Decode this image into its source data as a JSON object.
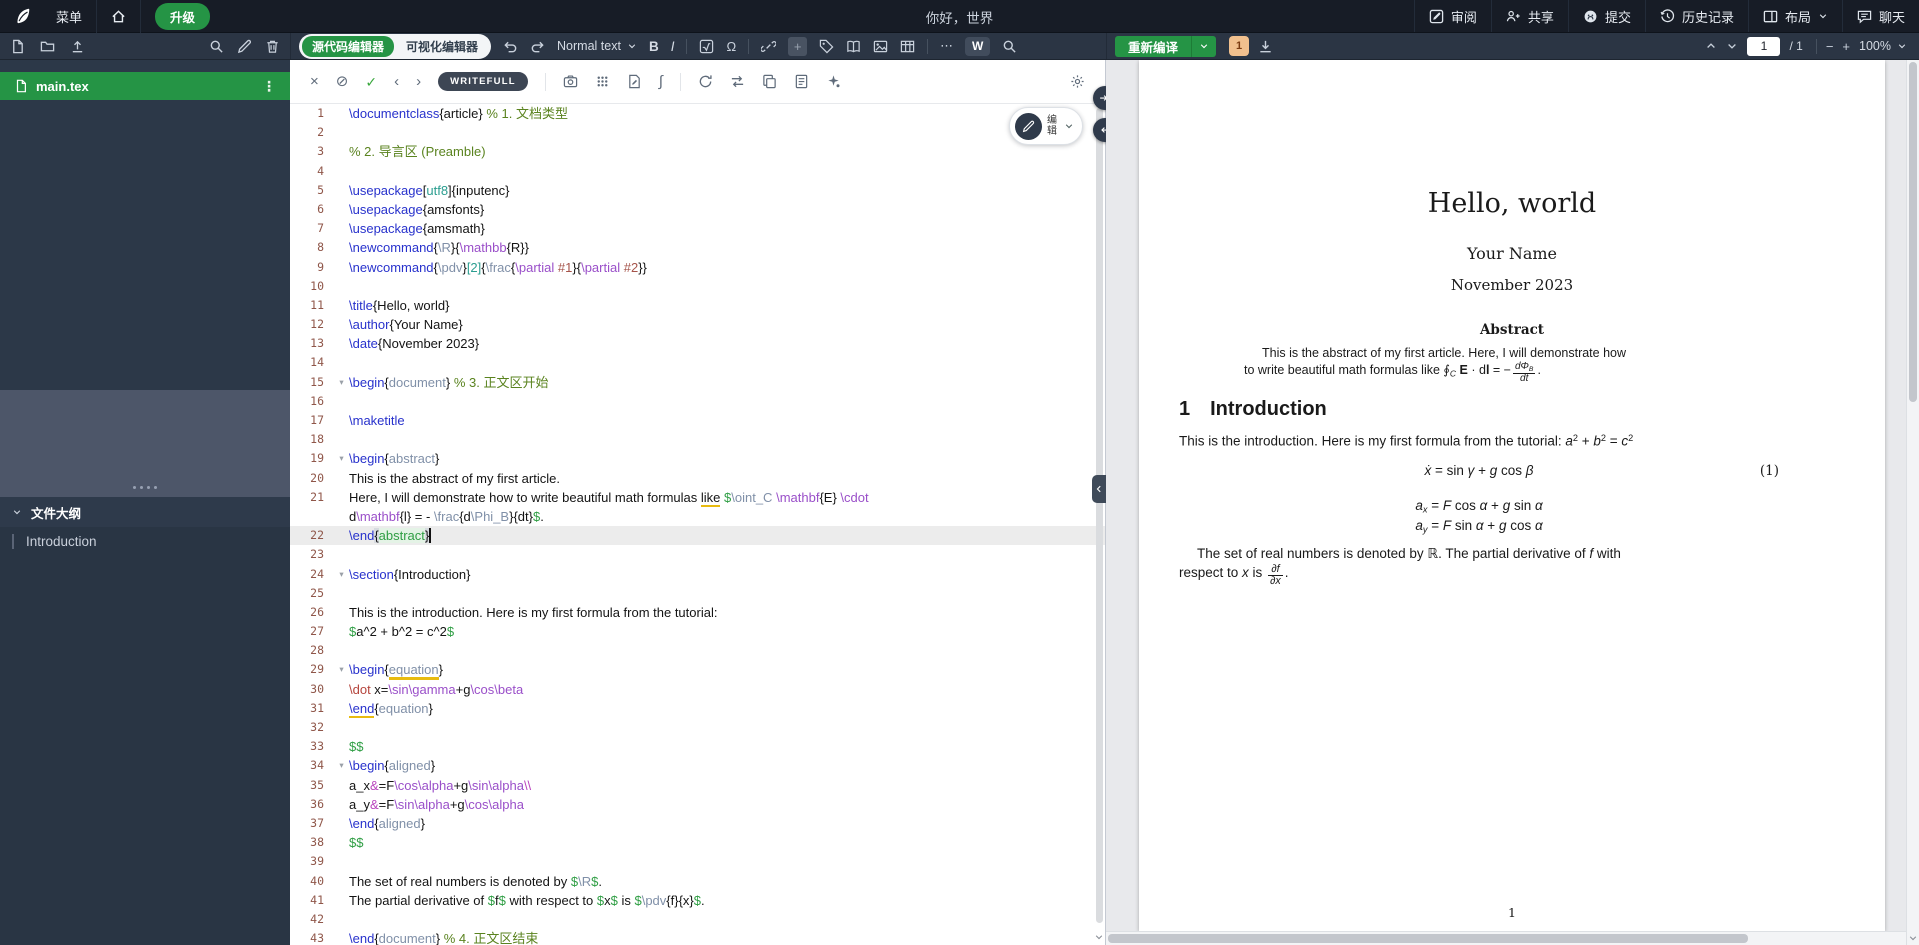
{
  "topbar": {
    "menu": "菜单",
    "upgrade": "升级",
    "project_title": "你好，世界",
    "review": "审阅",
    "share": "共享",
    "submit": "提交",
    "history": "历史记录",
    "layout": "布局",
    "chat": "聊天"
  },
  "toolbar": {
    "source_editor": "源代码编辑器",
    "visual_editor": "可视化编辑器",
    "paragraph_style": "Normal text",
    "bold": "B",
    "italic": "I",
    "omega": "Ω",
    "more": "⋯",
    "comment_plus": "+",
    "writefull_badge": "W"
  },
  "writefull": {
    "close": "×",
    "block": "⊘",
    "check": "✓",
    "prev": "‹",
    "next": "›",
    "label": "WRITEFULL",
    "integral": "∫"
  },
  "pdfbar": {
    "recompile": "重新编译",
    "logs_badge": "1",
    "page_current": "1",
    "page_total": "/ 1",
    "zoom": "100%",
    "zoom_minus": "−",
    "zoom_plus": "+"
  },
  "sidebar": {
    "file": "main.tex",
    "kebab": "⋮",
    "outline_header": "文件大纲",
    "outline_items": [
      "Introduction"
    ]
  },
  "edit_widget": {
    "label": "编辑"
  },
  "editor": {
    "rows": [
      {
        "n": "1",
        "s": [
          {
            "t": "\\documentclass",
            "c": "k"
          },
          {
            "t": "{article}"
          },
          {
            "t": " % 1. 文档类型",
            "c": "c0"
          }
        ]
      },
      {
        "n": "2",
        "s": []
      },
      {
        "n": "3",
        "s": [
          {
            "t": "% 2. 导言区 (Preamble)",
            "c": "c0"
          }
        ]
      },
      {
        "n": "4",
        "s": []
      },
      {
        "n": "5",
        "s": [
          {
            "t": "\\usepackage",
            "c": "k"
          },
          {
            "t": "["
          },
          {
            "t": "utf8",
            "c": "o"
          },
          {
            "t": "]{inputenc}"
          }
        ]
      },
      {
        "n": "6",
        "s": [
          {
            "t": "\\usepackage",
            "c": "k"
          },
          {
            "t": "{amsfonts}"
          }
        ]
      },
      {
        "n": "7",
        "s": [
          {
            "t": "\\usepackage",
            "c": "k"
          },
          {
            "t": "{amsmath}"
          }
        ]
      },
      {
        "n": "8",
        "s": [
          {
            "t": "\\newcommand",
            "c": "k"
          },
          {
            "t": "{"
          },
          {
            "t": "\\R",
            "c": "e"
          },
          {
            "t": "}{"
          },
          {
            "t": "\\mathbb",
            "c": "m"
          },
          {
            "t": "{R}}"
          }
        ]
      },
      {
        "n": "9",
        "s": [
          {
            "t": "\\newcommand",
            "c": "k"
          },
          {
            "t": "{"
          },
          {
            "t": "\\pdv",
            "c": "e"
          },
          {
            "t": "}"
          },
          {
            "t": "[2]",
            "c": "o"
          },
          {
            "t": "{"
          },
          {
            "t": "\\frac",
            "c": "e"
          },
          {
            "t": "{"
          },
          {
            "t": "\\partial",
            "c": "m"
          },
          {
            "t": " "
          },
          {
            "t": "#1",
            "c": "pr"
          },
          {
            "t": "}{"
          },
          {
            "t": "\\partial",
            "c": "m"
          },
          {
            "t": " "
          },
          {
            "t": "#2",
            "c": "pr"
          },
          {
            "t": "}}"
          }
        ]
      },
      {
        "n": "10",
        "s": []
      },
      {
        "n": "11",
        "s": [
          {
            "t": "\\title",
            "c": "k"
          },
          {
            "t": "{Hello, world}"
          }
        ]
      },
      {
        "n": "12",
        "s": [
          {
            "t": "\\author",
            "c": "k"
          },
          {
            "t": "{Your Name}"
          }
        ]
      },
      {
        "n": "13",
        "s": [
          {
            "t": "\\date",
            "c": "k"
          },
          {
            "t": "{November 2023}"
          }
        ]
      },
      {
        "n": "14",
        "s": []
      },
      {
        "n": "15",
        "f": 1,
        "s": [
          {
            "t": "\\begin",
            "c": "k"
          },
          {
            "t": "{"
          },
          {
            "t": "document",
            "c": "e"
          },
          {
            "t": "}"
          },
          {
            "t": " % 3. 正文区开始",
            "c": "c0"
          }
        ]
      },
      {
        "n": "16",
        "s": []
      },
      {
        "n": "17",
        "s": [
          {
            "t": "\\maketitle",
            "c": "k"
          }
        ]
      },
      {
        "n": "18",
        "s": []
      },
      {
        "n": "19",
        "f": 1,
        "s": [
          {
            "t": "\\begin",
            "c": "k"
          },
          {
            "t": "{"
          },
          {
            "t": "abstract",
            "c": "e"
          },
          {
            "t": "}"
          }
        ]
      },
      {
        "n": "20",
        "s": [
          {
            "t": "This is the abstract of my first article."
          }
        ]
      },
      {
        "n": "21",
        "s": [
          {
            "t": "Here, I will demonstrate how to write beautiful math formulas "
          },
          {
            "t": "like",
            "c": "sp"
          },
          {
            "t": " "
          },
          {
            "t": "$",
            "c": "d"
          },
          {
            "t": "\\oint_C",
            "c": "e"
          },
          {
            "t": " "
          },
          {
            "t": "\\mathbf",
            "c": "m"
          },
          {
            "t": "{E}"
          },
          {
            "t": " "
          },
          {
            "t": "\\cdot",
            "c": "m"
          }
        ]
      },
      {
        "n": "",
        "s": [
          {
            "t": "d"
          },
          {
            "t": "\\mathbf",
            "c": "m"
          },
          {
            "t": "{l} = - "
          },
          {
            "t": "\\frac",
            "c": "e"
          },
          {
            "t": "{d"
          },
          {
            "t": "\\Phi_B",
            "c": "e"
          },
          {
            "t": "}{dt}"
          },
          {
            "t": "$",
            "c": "d"
          },
          {
            "t": "."
          }
        ]
      },
      {
        "n": "22",
        "a": 1,
        "s": [
          {
            "t": "\\end",
            "c": "k"
          },
          {
            "t": "{",
            "c": "bm"
          },
          {
            "t": "abstract",
            "c": "em"
          },
          {
            "t": "}",
            "c": "bm"
          }
        ]
      },
      {
        "n": "23",
        "s": []
      },
      {
        "n": "24",
        "f": 1,
        "s": [
          {
            "t": "\\section",
            "c": "k"
          },
          {
            "t": "{Introduction}"
          }
        ]
      },
      {
        "n": "25",
        "s": []
      },
      {
        "n": "26",
        "s": [
          {
            "t": "This is the introduction. Here is my first formula from the tutorial:"
          }
        ]
      },
      {
        "n": "27",
        "s": [
          {
            "t": "$",
            "c": "d"
          },
          {
            "t": "a^2 + b^2 = c^2"
          },
          {
            "t": "$",
            "c": "d"
          }
        ]
      },
      {
        "n": "28",
        "s": []
      },
      {
        "n": "29",
        "f": 1,
        "s": [
          {
            "t": "\\begin",
            "c": "k"
          },
          {
            "t": "{"
          },
          {
            "t": "equation",
            "c": "e sp"
          },
          {
            "t": "}"
          }
        ]
      },
      {
        "n": "30",
        "s": [
          {
            "t": "\\dot",
            "c": "dt"
          },
          {
            "t": " x="
          },
          {
            "t": "\\sin\\gamma",
            "c": "m"
          },
          {
            "t": "+g"
          },
          {
            "t": "\\cos\\beta",
            "c": "m"
          }
        ]
      },
      {
        "n": "31",
        "s": [
          {
            "t": "\\end",
            "c": "k sp"
          },
          {
            "t": "{"
          },
          {
            "t": "equation",
            "c": "e"
          },
          {
            "t": "}"
          }
        ]
      },
      {
        "n": "32",
        "s": []
      },
      {
        "n": "33",
        "s": [
          {
            "t": "$$",
            "c": "d"
          }
        ]
      },
      {
        "n": "34",
        "f": 1,
        "s": [
          {
            "t": "\\begin",
            "c": "k"
          },
          {
            "t": "{"
          },
          {
            "t": "aligned",
            "c": "e"
          },
          {
            "t": "}"
          }
        ]
      },
      {
        "n": "35",
        "s": [
          {
            "t": "a_x"
          },
          {
            "t": "&",
            "c": "a"
          },
          {
            "t": "=F"
          },
          {
            "t": "\\cos\\alpha",
            "c": "m"
          },
          {
            "t": "+g"
          },
          {
            "t": "\\sin\\alpha",
            "c": "m"
          },
          {
            "t": "\\\\",
            "c": "a"
          }
        ]
      },
      {
        "n": "36",
        "s": [
          {
            "t": "a_y"
          },
          {
            "t": "&",
            "c": "a"
          },
          {
            "t": "=F"
          },
          {
            "t": "\\sin\\alpha",
            "c": "m"
          },
          {
            "t": "+g"
          },
          {
            "t": "\\cos\\alpha",
            "c": "m"
          }
        ]
      },
      {
        "n": "37",
        "s": [
          {
            "t": "\\end",
            "c": "k"
          },
          {
            "t": "{"
          },
          {
            "t": "aligned",
            "c": "e"
          },
          {
            "t": "}"
          }
        ]
      },
      {
        "n": "38",
        "s": [
          {
            "t": "$$",
            "c": "d"
          }
        ]
      },
      {
        "n": "39",
        "s": []
      },
      {
        "n": "40",
        "s": [
          {
            "t": "The set of real numbers is denoted by "
          },
          {
            "t": "$",
            "c": "d"
          },
          {
            "t": "\\R",
            "c": "e"
          },
          {
            "t": "$",
            "c": "d"
          },
          {
            "t": "."
          }
        ]
      },
      {
        "n": "41",
        "s": [
          {
            "t": "The partial derivative of "
          },
          {
            "t": "$",
            "c": "d"
          },
          {
            "t": "f"
          },
          {
            "t": "$",
            "c": "d"
          },
          {
            "t": " with respect to "
          },
          {
            "t": "$",
            "c": "d"
          },
          {
            "t": "x"
          },
          {
            "t": "$",
            "c": "d"
          },
          {
            "t": " is "
          },
          {
            "t": "$",
            "c": "d"
          },
          {
            "t": "\\pdv",
            "c": "e"
          },
          {
            "t": "{f}{x}"
          },
          {
            "t": "$",
            "c": "d"
          },
          {
            "t": "."
          }
        ]
      },
      {
        "n": "42",
        "s": []
      },
      {
        "n": "43",
        "s": [
          {
            "t": "\\end",
            "c": "k"
          },
          {
            "t": "{"
          },
          {
            "t": "document",
            "c": "e"
          },
          {
            "t": "}"
          },
          {
            "t": " % 4. 正文区结束",
            "c": "c0"
          }
        ]
      }
    ]
  },
  "pdf": {
    "title": "Hello, world",
    "author": "Your Name",
    "date": "November 2023",
    "abstract_heading": "Abstract",
    "abstract_line1": [
      {
        "t": "This is the abstract of my first article.  Here, I will demonstrate how"
      }
    ],
    "abstract_line2": [
      {
        "t": "to write beautiful math formulas like "
      },
      {
        "t": "∮",
        "c": "it"
      },
      {
        "t": "C",
        "c": "sub it"
      },
      {
        "t": " "
      },
      {
        "t": "E",
        "c": "bf"
      },
      {
        "t": " · d",
        "c": ""
      },
      {
        "t": "l",
        "c": "bf"
      },
      {
        "t": " = −",
        "c": ""
      },
      {
        "fr": {
          "n": [
            {
              "t": "dΦ",
              "c": "it"
            },
            {
              "t": "B",
              "c": "sub it"
            }
          ],
          "d": [
            {
              "t": "dt",
              "c": "it"
            }
          ]
        }
      },
      {
        "t": "."
      }
    ],
    "section_number": "1",
    "section_title": "Introduction",
    "intro_line": [
      {
        "t": "This is the introduction. Here is my first formula from the tutorial: "
      },
      {
        "t": "a",
        "c": "it"
      },
      {
        "t": "2",
        "c": "sup"
      },
      {
        "t": " + "
      },
      {
        "t": "b",
        "c": "it"
      },
      {
        "t": "2",
        "c": "sup"
      },
      {
        "t": " = "
      },
      {
        "t": "c",
        "c": "it"
      },
      {
        "t": "2",
        "c": "sup"
      }
    ],
    "equation": [
      {
        "t": "ẋ",
        "c": "it"
      },
      {
        "t": " = sin "
      },
      {
        "t": "γ",
        "c": "it"
      },
      {
        "t": " + "
      },
      {
        "t": "g",
        "c": "it"
      },
      {
        "t": " cos "
      },
      {
        "t": "β",
        "c": "it"
      }
    ],
    "equation_number": "(1)",
    "align_line1": [
      {
        "t": "a",
        "c": "it"
      },
      {
        "t": "x",
        "c": "sub it"
      },
      {
        "t": " = "
      },
      {
        "t": "F",
        "c": "it"
      },
      {
        "t": " cos "
      },
      {
        "t": "α",
        "c": "it"
      },
      {
        "t": " + "
      },
      {
        "t": "g",
        "c": "it"
      },
      {
        "t": " sin "
      },
      {
        "t": "α",
        "c": "it"
      }
    ],
    "align_line2": [
      {
        "t": "a",
        "c": "it"
      },
      {
        "t": "y",
        "c": "sub it"
      },
      {
        "t": " = "
      },
      {
        "t": "F",
        "c": "it"
      },
      {
        "t": " sin "
      },
      {
        "t": "α",
        "c": "it"
      },
      {
        "t": " + "
      },
      {
        "t": "g",
        "c": "it"
      },
      {
        "t": " cos "
      },
      {
        "t": "α",
        "c": "it"
      }
    ],
    "closing_line1": [
      {
        "t": "The set of real numbers is denoted by ℝ. The partial derivative of "
      },
      {
        "t": "f",
        "c": "it"
      },
      {
        "t": " with"
      }
    ],
    "closing_line2": [
      {
        "t": "respect to "
      },
      {
        "t": "x",
        "c": "it"
      },
      {
        "t": " is "
      },
      {
        "fr": {
          "n": [
            {
              "t": "∂f",
              "c": "it"
            }
          ],
          "d": [
            {
              "t": "∂x",
              "c": "it"
            }
          ]
        }
      },
      {
        "t": "."
      }
    ],
    "page_number": "1"
  }
}
